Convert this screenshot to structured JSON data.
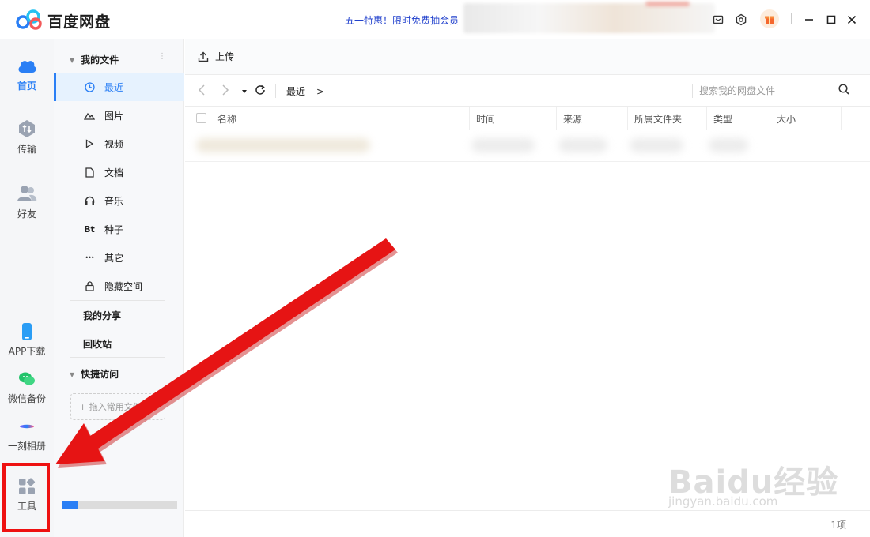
{
  "app": {
    "title": "百度网盘",
    "promo_text": "五一特惠！限时免费抽会员"
  },
  "colors": {
    "accent": "#2a7ff5",
    "annotation_red": "#e11111",
    "promo_blue": "#1f3fcc"
  },
  "leftnav": {
    "items": [
      {
        "label": "首页",
        "icon": "cloud-home-icon",
        "active": true
      },
      {
        "label": "传输",
        "icon": "transfer-icon",
        "active": false
      },
      {
        "label": "好友",
        "icon": "friends-icon",
        "active": false
      },
      {
        "label": "APP下载",
        "icon": "phone-download-icon",
        "active": false
      },
      {
        "label": "微信备份",
        "icon": "wechat-backup-icon",
        "active": false
      },
      {
        "label": "一刻相册",
        "icon": "album-icon",
        "active": false
      },
      {
        "label": "工具",
        "icon": "tools-grid-icon",
        "active": false
      }
    ]
  },
  "sidebar": {
    "my_files": "我的文件",
    "categories": [
      {
        "label": "最近",
        "icon": "clock-icon",
        "active": true
      },
      {
        "label": "图片",
        "icon": "image-icon",
        "active": false
      },
      {
        "label": "视频",
        "icon": "play-icon",
        "active": false
      },
      {
        "label": "文档",
        "icon": "document-icon",
        "active": false
      },
      {
        "label": "音乐",
        "icon": "headphones-icon",
        "active": false
      },
      {
        "label": "种子",
        "icon": "bt-icon",
        "active": false
      },
      {
        "label": "其它",
        "icon": "more-dots-icon",
        "active": false
      },
      {
        "label": "隐藏空间",
        "icon": "lock-icon",
        "active": false
      }
    ],
    "my_share": "我的分享",
    "recycle_bin": "回收站",
    "quick_access": "快捷访问",
    "drop_hint": "+ 拖入常用文件夹",
    "bt_glyph": "Bt",
    "dots_glyph": "•••",
    "storage_used_fraction": 0.13
  },
  "toolbar": {
    "upload_label": "上传"
  },
  "path": {
    "current": "最近",
    "chevron": ">",
    "search_placeholder": "搜索我的网盘文件"
  },
  "table": {
    "columns": [
      "名称",
      "时间",
      "来源",
      "所属文件夹",
      "类型",
      "大小"
    ]
  },
  "footer": {
    "count": "1项"
  },
  "watermark": {
    "brand": "Baidu经验",
    "url": "jingyan.baidu.com"
  }
}
